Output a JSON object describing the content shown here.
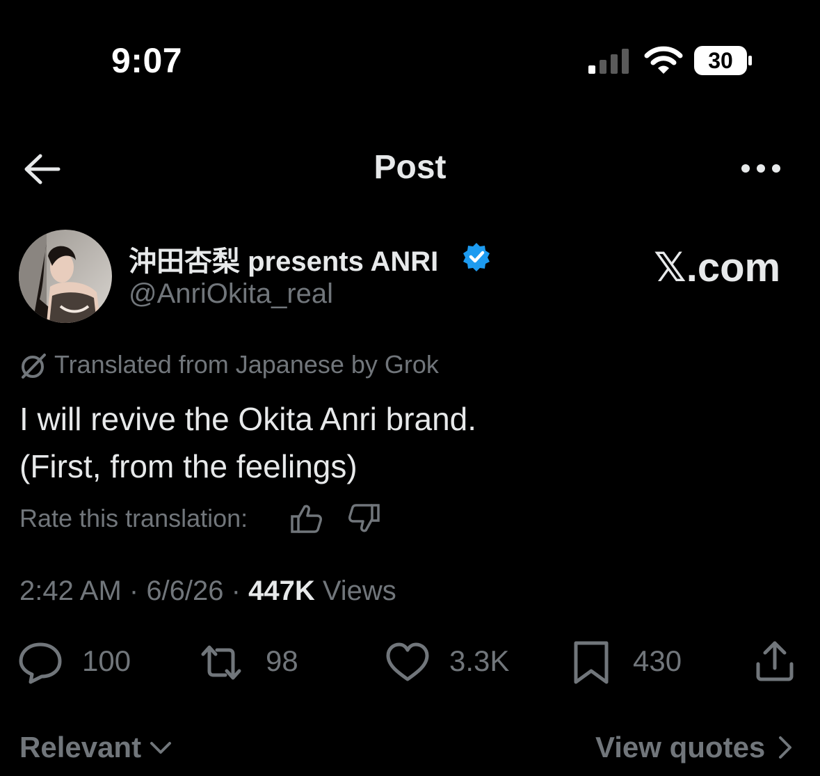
{
  "status_bar": {
    "time": "9:07",
    "battery_level": "30",
    "signal_icon": "cellular-signal-icon",
    "wifi_icon": "wifi-icon",
    "battery_icon": "battery-icon"
  },
  "header": {
    "title": "Post",
    "back_icon": "arrow-left-icon",
    "more_icon": "ellipsis-icon"
  },
  "author": {
    "name": "沖田杏梨 presents ANRI",
    "handle": "@AnriOkita_real",
    "verified_color": "#1d9bf0"
  },
  "watermark": "𝕏.com",
  "translation": {
    "label": "Translated from Japanese by Grok",
    "rate_label": "Rate this translation:"
  },
  "post": {
    "lines": [
      "I will revive the Okita Anri brand.",
      "(First, from the feelings)"
    ]
  },
  "meta": {
    "time": "2:42 AM",
    "separator": " · ",
    "date": "6/6/26",
    "views_count": "447K",
    "views_label": " Views"
  },
  "actions": {
    "replies": "100",
    "reposts": "98",
    "likes": "3.3K",
    "bookmarks": "430"
  },
  "footer": {
    "sort_label": "Relevant",
    "quotes_label": "View quotes"
  },
  "colors": {
    "background": "#000000",
    "primary_text": "#e7e9ea",
    "secondary_text": "#71767b",
    "accent": "#1d9bf0"
  }
}
